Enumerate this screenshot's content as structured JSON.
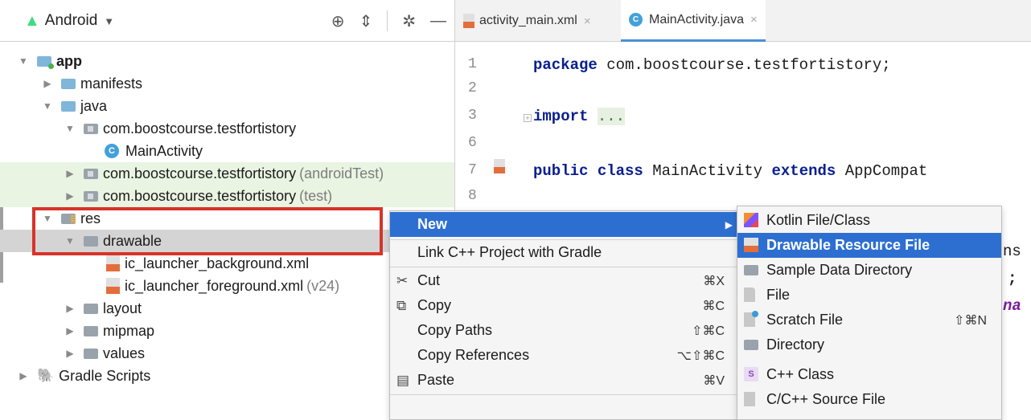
{
  "project_panel": {
    "view_label": "Android",
    "tree": [
      {
        "label": "app"
      },
      {
        "label": "manifests"
      },
      {
        "label": "java"
      },
      {
        "label": "com.boostcourse.testfortistory"
      },
      {
        "label": "MainActivity",
        "icon": "C"
      },
      {
        "label": "com.boostcourse.testfortistory",
        "suffix": "(androidTest)"
      },
      {
        "label": "com.boostcourse.testfortistory",
        "suffix": "(test)"
      },
      {
        "label": "res"
      },
      {
        "label": "drawable"
      },
      {
        "label": "ic_launcher_background.xml"
      },
      {
        "label": "ic_launcher_foreground.xml",
        "suffix": "(v24)"
      },
      {
        "label": "layout"
      },
      {
        "label": "mipmap"
      },
      {
        "label": "values"
      },
      {
        "label": "Gradle Scripts"
      }
    ]
  },
  "editor": {
    "tabs": [
      {
        "label": "activity_main.xml",
        "close": "×"
      },
      {
        "label": "MainActivity.java",
        "close": "×"
      }
    ],
    "line_numbers": [
      "1",
      "2",
      "3",
      "6",
      "7",
      "8"
    ],
    "code": {
      "line1_kw": "package",
      "line1_rest": " com.boostcourse.testfortistory;",
      "line3_kw": "import",
      "line3_rest": "...",
      "line7_kw1": "public",
      "line7_kw2": "class",
      "line7_mid": " MainActivity ",
      "line7_kw3": "extends",
      "line7_rest": " AppCompat"
    },
    "edge_fragments": [
      "ns",
      ";",
      "na"
    ]
  },
  "context_menu": {
    "items": [
      {
        "label": "New",
        "shortcut": ""
      },
      {
        "label": "Link C++ Project with Gradle",
        "shortcut": ""
      },
      {
        "label": "Cut",
        "shortcut": "⌘X",
        "icon": "✂"
      },
      {
        "label": "Copy",
        "shortcut": "⌘C",
        "icon": "⧉"
      },
      {
        "label": "Copy Paths",
        "shortcut": "⇧⌘C"
      },
      {
        "label": "Copy References",
        "shortcut": "⌥⇧⌘C"
      },
      {
        "label": "Paste",
        "shortcut": "⌘V",
        "icon": "📋"
      }
    ]
  },
  "submenu": {
    "items": [
      {
        "label": "Kotlin File/Class",
        "shortcut": ""
      },
      {
        "label": "Drawable Resource File",
        "shortcut": ""
      },
      {
        "label": "Sample Data Directory",
        "shortcut": ""
      },
      {
        "label": "File",
        "shortcut": ""
      },
      {
        "label": "Scratch File",
        "shortcut": "⇧⌘N"
      },
      {
        "label": "Directory",
        "shortcut": ""
      },
      {
        "label": "C++ Class",
        "shortcut": ""
      },
      {
        "label": "C/C++ Source File",
        "shortcut": ""
      }
    ]
  },
  "colors": {
    "accent_selection": "#2d6fd1",
    "annotation_box": "#d7332a",
    "keyword": "#0a1f8f"
  }
}
